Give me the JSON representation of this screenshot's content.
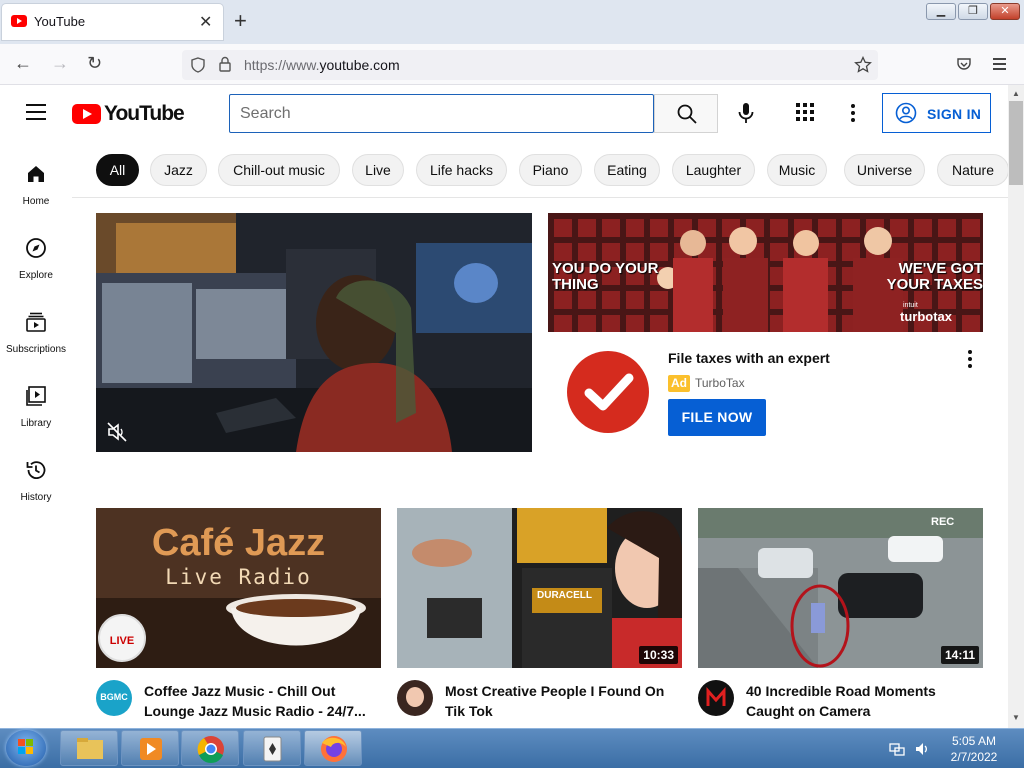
{
  "browser": {
    "tab_title": "YouTube",
    "url_prefix": "https://www.",
    "url_host": "youtube.com"
  },
  "header": {
    "logo_text": "YouTube",
    "search_placeholder": "Search",
    "sign_in_label": "SIGN IN"
  },
  "sidebar": {
    "items": [
      {
        "label": "Home",
        "icon": "home-icon"
      },
      {
        "label": "Explore",
        "icon": "compass-icon"
      },
      {
        "label": "Subscriptions",
        "icon": "subscriptions-icon"
      },
      {
        "label": "Library",
        "icon": "library-icon"
      },
      {
        "label": "History",
        "icon": "history-icon"
      }
    ]
  },
  "chips": [
    "All",
    "Jazz",
    "Chill-out music",
    "Live",
    "Life hacks",
    "Piano",
    "Eating",
    "Laughter",
    "Music",
    "Universe",
    "Nature"
  ],
  "ad": {
    "banner_left": "YOU DO YOUR THING",
    "banner_right": "WE'VE GOT YOUR TAXES",
    "banner_brand": "turbotax",
    "banner_brand_prefix": "intuit",
    "title": "File taxes with an expert",
    "badge": "Ad",
    "sponsor": "TurboTax",
    "cta": "FILE NOW"
  },
  "videos": [
    {
      "title_line1": "Coffee Jazz Music - Chill Out",
      "title_line2": "Lounge Jazz Music Radio - 24/7...",
      "thumb_text1": "Café Jazz",
      "thumb_text2": "Live Radio",
      "thumb_badge": "LIVE",
      "channel_avatar_text": "BGMC"
    },
    {
      "title_line1": "Most Creative People I Found On",
      "title_line2": "Tik Tok",
      "duration": "10:33",
      "thumb_text": "DURACELL"
    },
    {
      "title_line1": "40 Incredible Road Moments",
      "title_line2": "Caught on Camera",
      "duration": "14:11",
      "thumb_text": "REC"
    }
  ],
  "taskbar": {
    "time": "5:05 AM",
    "date": "2/7/2022"
  },
  "colors": {
    "youtube_red": "#ff0000",
    "link_blue": "#065fd4",
    "turbotax_red": "#d52b1e"
  }
}
